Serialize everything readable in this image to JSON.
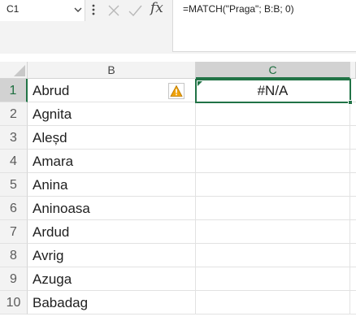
{
  "name_box": {
    "value": "C1"
  },
  "formula_bar": {
    "fx_label": "fx",
    "formula": "=MATCH(\"Praga\"; B:B; 0)"
  },
  "columns": {
    "b": "B",
    "c": "C"
  },
  "rows": [
    {
      "num": "1",
      "b": "Abrud",
      "c": "#N/A"
    },
    {
      "num": "2",
      "b": "Agnita",
      "c": ""
    },
    {
      "num": "3",
      "b": "Aleșd",
      "c": ""
    },
    {
      "num": "4",
      "b": "Amara",
      "c": ""
    },
    {
      "num": "5",
      "b": "Anina",
      "c": ""
    },
    {
      "num": "6",
      "b": "Aninoasa",
      "c": ""
    },
    {
      "num": "7",
      "b": "Ardud",
      "c": ""
    },
    {
      "num": "8",
      "b": "Avrig",
      "c": ""
    },
    {
      "num": "9",
      "b": "Azuga",
      "c": ""
    },
    {
      "num": "10",
      "b": "Babadag",
      "c": ""
    }
  ],
  "colors": {
    "accent": "#217346",
    "warning": "#f0a30a"
  },
  "icons": [
    "chevron-down-icon",
    "more-vertical-icon",
    "cancel-icon",
    "enter-check-icon",
    "fx-icon",
    "warning-icon"
  ]
}
